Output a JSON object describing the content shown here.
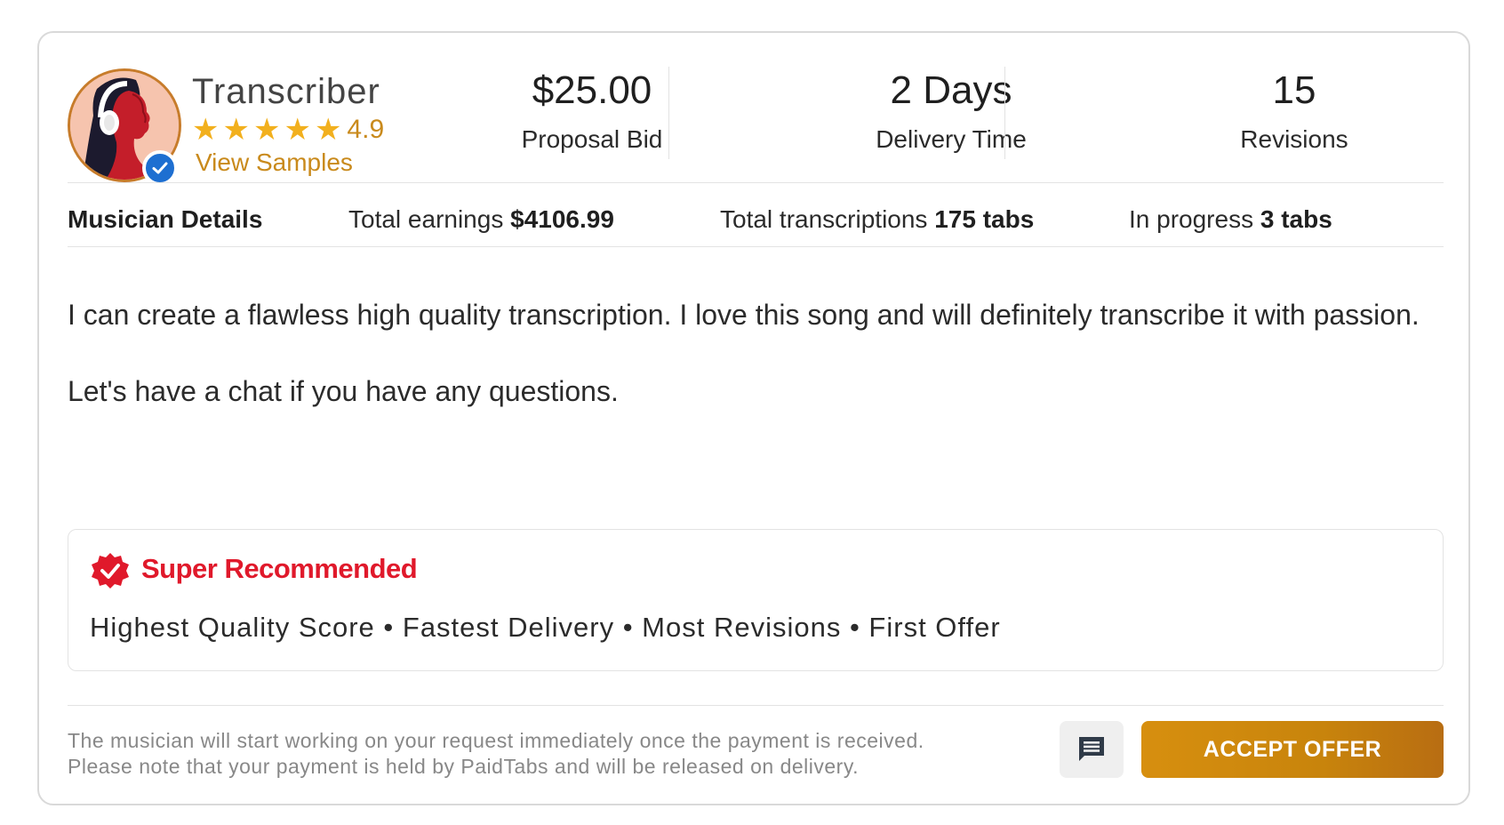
{
  "profile": {
    "name": "Transcriber",
    "rating": "4.9",
    "star_count": 5,
    "view_samples_label": "View Samples",
    "avatar_icon": "woman-with-headphones-avatar",
    "verified_icon": "check-badge-icon"
  },
  "stats": {
    "bid_value": "$25.00",
    "bid_label": "Proposal Bid",
    "delivery_value": "2 Days",
    "delivery_label": "Delivery Time",
    "revisions_value": "15",
    "revisions_label": "Revisions"
  },
  "details": {
    "heading": "Musician Details",
    "earnings_label": "Total earnings",
    "earnings_value": "$4106.99",
    "transcriptions_label": "Total transcriptions",
    "transcriptions_value": "175 tabs",
    "in_progress_label": "In progress",
    "in_progress_value": "3 tabs"
  },
  "message": {
    "paragraph1": "I can create a flawless high quality transcription. I love this song and will definitely transcribe it with passion.",
    "paragraph2": "Let's have a chat if you have any questions."
  },
  "recommendation": {
    "title": "Super Recommended",
    "tags": "Highest Quality Score • Fastest Delivery • Most Revisions • First Offer",
    "badge_icon": "verified-seal-icon"
  },
  "footer": {
    "note_line1": "The musician will start working on your request immediately once the payment is received.",
    "note_line2": "Please note that your payment is held by PaidTabs and will be released on delivery.",
    "chat_icon": "chat-message-icon",
    "accept_label": "ACCEPT OFFER"
  },
  "colors": {
    "accent": "#c98a1c",
    "star": "#f2b01e",
    "recommend_red": "#e0192b",
    "verified_blue": "#1e6fd1",
    "button_gradient_start": "#d78f0f",
    "button_gradient_end": "#b86d12"
  }
}
